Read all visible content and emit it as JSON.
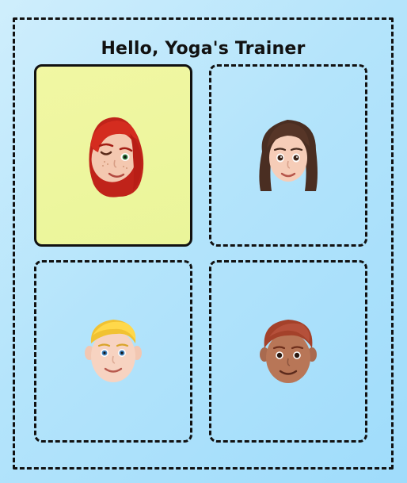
{
  "header": {
    "title": "Hello, Yoga's Trainer"
  },
  "avatars": [
    {
      "icon": "redhead-winking-woman-memoji-icon",
      "selected": true
    },
    {
      "icon": "brunette-woman-memoji-icon",
      "selected": false
    },
    {
      "icon": "blond-boy-memoji-icon",
      "selected": false
    },
    {
      "icon": "auburn-haired-boy-memoji-icon",
      "selected": false
    }
  ],
  "colors": {
    "selected_card": "#eef69e",
    "border": "#111111",
    "background": "#b4e4fb"
  }
}
